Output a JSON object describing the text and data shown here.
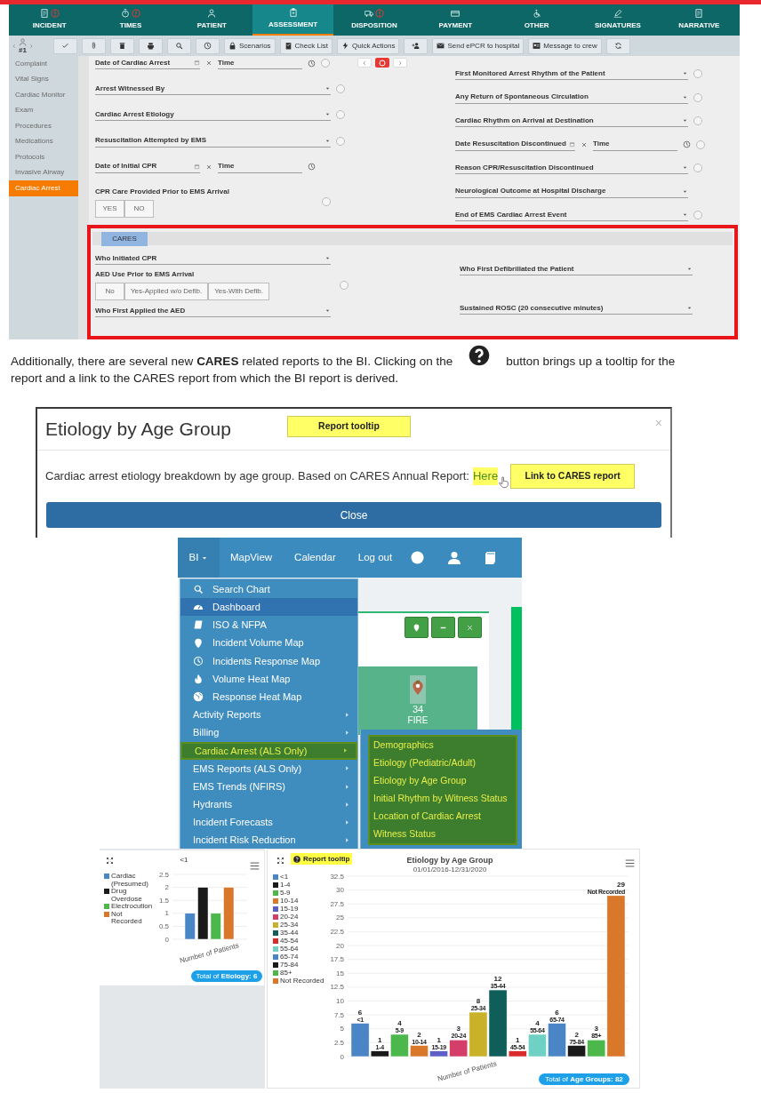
{
  "app": {
    "nav_tabs": [
      {
        "label": "INCIDENT",
        "selected": false,
        "alert": true
      },
      {
        "label": "TIMES",
        "selected": false,
        "alert": true
      },
      {
        "label": "PATIENT",
        "selected": false,
        "alert": false
      },
      {
        "label": "ASSESSMENT",
        "selected": true,
        "alert": false
      },
      {
        "label": "DISPOSITION",
        "selected": false,
        "alert": true
      },
      {
        "label": "PAYMENT",
        "selected": false,
        "alert": false
      },
      {
        "label": "OTHER",
        "selected": false,
        "alert": false
      },
      {
        "label": "SIGNATURES",
        "selected": false,
        "alert": false
      },
      {
        "label": "NARRATIVE",
        "selected": false,
        "alert": false
      }
    ],
    "record": "#1",
    "toolbar": [
      {
        "kind": "check"
      },
      {
        "kind": "clip"
      },
      {
        "kind": "trash"
      },
      {
        "kind": "print"
      },
      {
        "kind": "search"
      },
      {
        "kind": "clock"
      },
      {
        "kind": "lock",
        "label": "Scenarios"
      },
      {
        "kind": "list",
        "label": "Check List"
      },
      {
        "kind": "bolt",
        "label": "Quick Actions"
      },
      {
        "kind": "personplus"
      },
      {
        "kind": "mail",
        "label": "Send ePCR to hospital"
      },
      {
        "kind": "chat",
        "label": "Message to crew"
      },
      {
        "kind": "refresh"
      }
    ],
    "sidebar": [
      {
        "label": "Complaint",
        "selected": false
      },
      {
        "label": "Vital Signs",
        "selected": false
      },
      {
        "label": "Cardiac Monitor",
        "selected": false
      },
      {
        "label": "Exam",
        "selected": false
      },
      {
        "label": "Procedures",
        "selected": false
      },
      {
        "label": "Medications",
        "selected": false
      },
      {
        "label": "Protocols",
        "selected": false
      },
      {
        "label": "Invasive Airway",
        "selected": false
      },
      {
        "label": "Cardiac Arrest",
        "selected": true
      }
    ],
    "fields_left": [
      {
        "kind": "datetime",
        "label": "Date of Cardiac Arrest",
        "time_label": "Time",
        "circle": true
      },
      {
        "kind": "select",
        "label": "Arrest Witnessed By",
        "circle": true
      },
      {
        "kind": "select",
        "label": "Cardiac Arrest Etiology",
        "circle": true
      },
      {
        "kind": "select",
        "label": "Resuscitation Attempted by EMS",
        "circle": true
      },
      {
        "kind": "datetime",
        "label": "Date of Initial CPR",
        "time_label": "Time",
        "circle": false
      },
      {
        "kind": "toggle",
        "label": "CPR Care Provided Prior to EMS Arrival",
        "options": [
          "YES",
          "NO"
        ],
        "circle": true
      }
    ],
    "fields_right": [
      {
        "kind": "select",
        "label": "First Monitored Arrest Rhythm of the Patient",
        "circle": true
      },
      {
        "kind": "select",
        "label": "Any Return of Spontaneous Circulation",
        "circle": true
      },
      {
        "kind": "select",
        "label": "Cardiac Rhythm on Arrival at Destination",
        "circle": true
      },
      {
        "kind": "datetime",
        "label": "Date Resuscitation Discontinued",
        "time_label": "Time",
        "circle": true
      },
      {
        "kind": "select",
        "label": "Reason CPR/Resuscitation Discontinued",
        "circle": true
      },
      {
        "kind": "select",
        "label": "Neurological Outcome at Hospital Discharge",
        "circle": false
      },
      {
        "kind": "select",
        "label": "End of EMS Cardiac Arrest Event",
        "circle": true
      }
    ],
    "cares": {
      "tab": "CARES",
      "fields_left": [
        {
          "kind": "select",
          "label": "Who Initiated CPR"
        },
        {
          "kind": "toggle",
          "label": "AED Use Prior to EMS Arrival",
          "options": [
            "No",
            "Yes-Applied w/o Defib.",
            "Yes-With Defib."
          ]
        },
        {
          "kind": "select",
          "label": "Who First Applied the AED"
        }
      ],
      "fields_right": [
        {
          "kind": "select",
          "label": "Who First Defibrillated the Patient"
        },
        {
          "kind": "select",
          "label": "Sustained ROSC (20 consecutive minutes)"
        }
      ]
    }
  },
  "paragraph": {
    "before": "Additionally, there are several new **CARES** related reports to the BI. Clicking on the",
    "after": "button brings up a tooltip for the",
    "line2": "report and a link to the CARES report from which the BI report is derived."
  },
  "dialog": {
    "title": "Etiology by Age Group",
    "close_icon": "×",
    "callout_tooltip": "Report tooltip",
    "body": "Cardiac arrest etiology breakdown by age group. Based on CARES Annual Report:",
    "link": "Here",
    "callout_link": "Link to CARES report",
    "button": "Close"
  },
  "menu": {
    "nav": [
      "BI",
      "MapView",
      "Calendar",
      "Log out"
    ],
    "items": [
      {
        "kind": "icon",
        "label": "Search Chart",
        "selected": false
      },
      {
        "kind": "icon",
        "label": "Dashboard",
        "selected": true
      },
      {
        "kind": "icon",
        "label": "ISO & NFPA",
        "selected": false
      },
      {
        "kind": "icon",
        "label": "Incident Volume Map",
        "selected": false
      },
      {
        "kind": "icon",
        "label": "Incidents Response Map",
        "selected": false
      },
      {
        "kind": "icon",
        "label": "Volume Heat Map",
        "selected": false
      },
      {
        "kind": "icon",
        "label": "Response Heat Map",
        "selected": false
      },
      {
        "kind": "submenu",
        "label": "Activity Reports",
        "selected": false
      },
      {
        "kind": "submenu",
        "label": "Billing",
        "selected": false
      },
      {
        "kind": "submenu",
        "label": "Cardiac Arrest (ALS Only)",
        "selected": true
      },
      {
        "kind": "submenu",
        "label": "EMS Reports (ALS Only)",
        "selected": false
      },
      {
        "kind": "submenu",
        "label": "EMS Trends (NFIRS)",
        "selected": false
      },
      {
        "kind": "submenu",
        "label": "Hydrants",
        "selected": false
      },
      {
        "kind": "submenu",
        "label": "Incident Forecasts",
        "selected": false
      },
      {
        "kind": "submenu",
        "label": "Incident Risk Reduction",
        "selected": false
      }
    ],
    "submenu": [
      "Demographics",
      "Etiology (Pediatric/Adult)",
      "Etiology by Age Group",
      "Initial Rhythm by Witness Status",
      "Location of Cardiac Arrest",
      "Witness Status"
    ],
    "card_count": "34",
    "card_label": "FIRE",
    "marker_label": "#"
  },
  "charts": [
    {
      "button": "Total of **Etiology: 6**",
      "chart_data": {
        "type": "bar",
        "title": "<1",
        "categories": [
          "Number of Patients"
        ],
        "grid": true,
        "ylim": [
          0,
          2.5
        ],
        "yticks": [
          0,
          0.5,
          1,
          1.5,
          2,
          2.5
        ],
        "series": [
          {
            "name": "Cardiac (Presumed)",
            "color": "#4a86c5",
            "values": [
              1
            ]
          },
          {
            "name": "Drug Overdose",
            "color": "#1a1a1a",
            "values": [
              2
            ]
          },
          {
            "name": "Electrocution",
            "color": "#4cb84c",
            "values": [
              1
            ]
          },
          {
            "name": "Not Recorded",
            "color": "#d9772b",
            "values": [
              2
            ]
          }
        ]
      }
    },
    {
      "tooltip": "Report tooltip",
      "subtitle": "01/01/2016-12/31/2020",
      "button": "Total of **Age Groups: 82**",
      "chart_data": {
        "type": "bar",
        "title": "Etiology by Age Group",
        "categories": [
          "Number of Patients"
        ],
        "grid": true,
        "ylim": [
          0,
          32.5
        ],
        "yticks": [
          0,
          2.5,
          5,
          7.5,
          10,
          12.5,
          15,
          17.5,
          20,
          22.5,
          25,
          27.5,
          30,
          32.5
        ],
        "data_labels": true,
        "series": [
          {
            "name": "<1",
            "color": "#4a86c5",
            "values": [
              6
            ]
          },
          {
            "name": "1-4",
            "color": "#1a1a1a",
            "values": [
              1
            ]
          },
          {
            "name": "5-9",
            "color": "#4cb84c",
            "values": [
              4
            ]
          },
          {
            "name": "10-14",
            "color": "#d9772b",
            "values": [
              2
            ]
          },
          {
            "name": "15-19",
            "color": "#5b5fc7",
            "values": [
              1
            ]
          },
          {
            "name": "20-24",
            "color": "#d43f6a",
            "values": [
              3
            ]
          },
          {
            "name": "25-34",
            "color": "#c9b22a",
            "values": [
              8
            ]
          },
          {
            "name": "35-44",
            "color": "#0f5e5a",
            "values": [
              12
            ]
          },
          {
            "name": "45-54",
            "color": "#d92b2b",
            "values": [
              1
            ]
          },
          {
            "name": "55-64",
            "color": "#6fd1c4",
            "values": [
              4
            ]
          },
          {
            "name": "65-74",
            "color": "#4a86c5",
            "values": [
              6
            ]
          },
          {
            "name": "75-84",
            "color": "#1a1a1a",
            "values": [
              2
            ]
          },
          {
            "name": "85+",
            "color": "#4cb84c",
            "values": [
              3
            ]
          },
          {
            "name": "Not Recorded",
            "color": "#d9772b",
            "values": [
              29
            ]
          }
        ]
      }
    }
  ]
}
